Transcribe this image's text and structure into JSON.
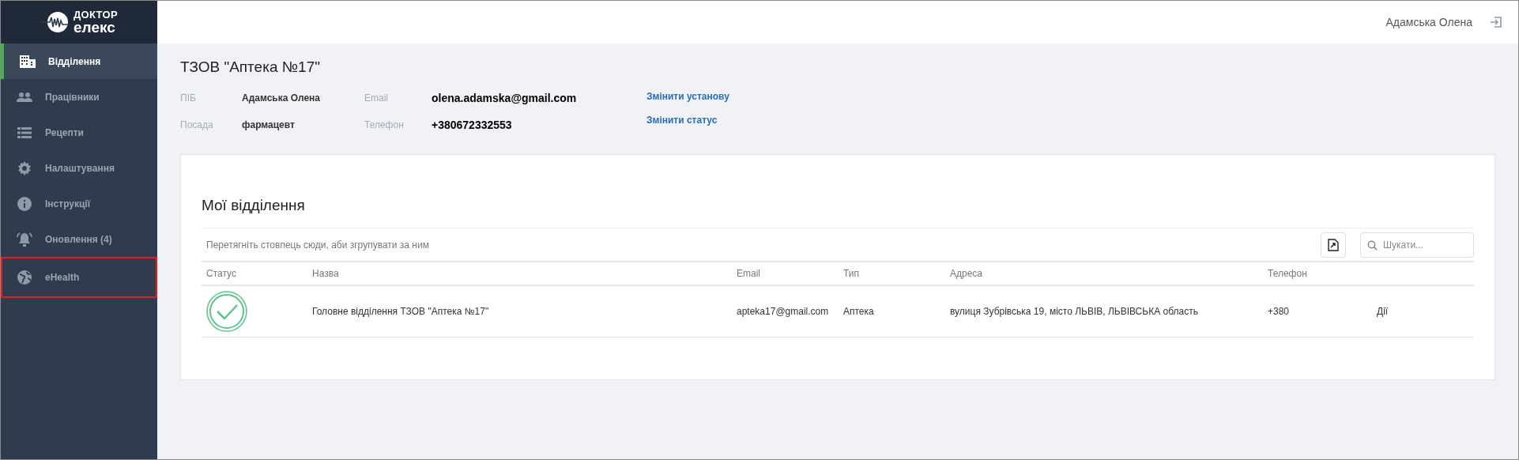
{
  "sidebar": {
    "logo": {
      "line_1": "ДОКТОР",
      "line_2": "елекс"
    },
    "items": [
      {
        "label": "Відділення",
        "selected": true,
        "highlighted": false
      },
      {
        "label": "Працівники",
        "selected": false,
        "highlighted": false
      },
      {
        "label": "Рецепти",
        "selected": false,
        "highlighted": false
      },
      {
        "label": "Налаштування",
        "selected": false,
        "highlighted": false
      },
      {
        "label": "Інструкції",
        "selected": false,
        "highlighted": false
      },
      {
        "label": "Оновлення (4)",
        "selected": false,
        "highlighted": false
      },
      {
        "label": "eHealth",
        "selected": false,
        "highlighted": true
      }
    ]
  },
  "header": {
    "user": "Адамська Олена"
  },
  "organization": {
    "title": "ТЗОВ \"Аптека №17\"",
    "fields": [
      {
        "label": "ПІБ",
        "value": "Адамська Олена"
      },
      {
        "label": "Email",
        "value": "olena.adamska@gmail.com"
      },
      {
        "label": "Посада",
        "value": "фармацевт"
      },
      {
        "label": "Телефон",
        "value": "+380672332553"
      }
    ],
    "links": [
      "Змінити установу",
      "Змінити статус"
    ]
  },
  "departments": {
    "title": "Мої відділення",
    "group_hint": "Перетягніть стовпець сюди, аби згрупувати за ним",
    "search": {
      "placeholder": "Шукати..."
    },
    "columns": [
      "Статус",
      "Назва",
      "Email",
      "Тип",
      "Адреса",
      "Телефон"
    ],
    "rows": [
      {
        "active": true,
        "name": "Головне відділення ТЗОВ \"Аптека №17\"",
        "email": "apteka17@gmail.com",
        "type": "Аптека",
        "address": "вулиця Зубрівська 19, місто ЛЬВІВ, ЛЬВІВСЬКА область",
        "phone": "+380",
        "action": "Дії"
      }
    ]
  }
}
